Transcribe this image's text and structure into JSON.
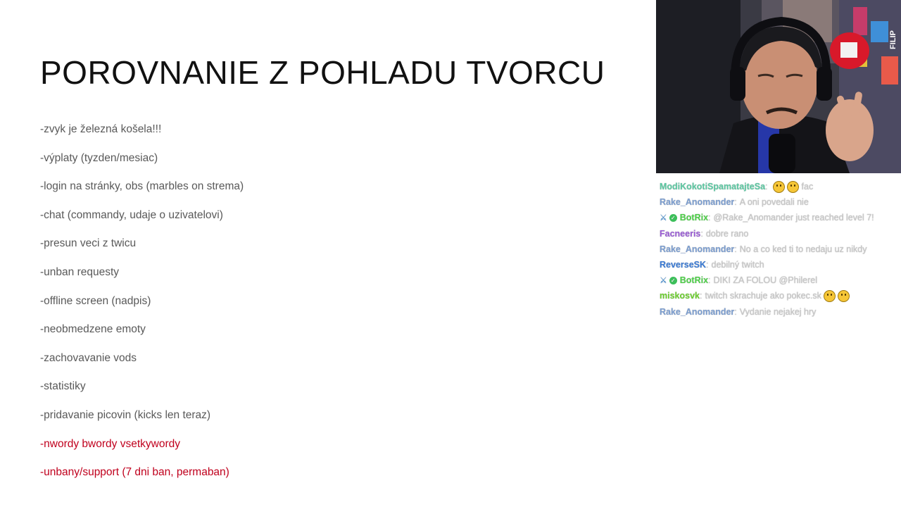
{
  "slide": {
    "title": "POROVNANIE Z POHLADU TVORCU",
    "bullets": [
      {
        "text": "-zvyk je železná košela!!!",
        "color": "#595959"
      },
      {
        "text": "-výplaty (tyzden/mesiac)",
        "color": "#595959"
      },
      {
        "text": "-login na stránky, obs (marbles on strema)",
        "color": "#595959"
      },
      {
        "text": "-chat (commandy, udaje o uzivatelovi)",
        "color": "#595959"
      },
      {
        "text": "-presun veci z twicu",
        "color": "#595959"
      },
      {
        "text": "-unban requesty",
        "color": "#595959"
      },
      {
        "text": "-offline screen (nadpis)",
        "color": "#595959"
      },
      {
        "text": "-neobmedzene emoty",
        "color": "#595959"
      },
      {
        "text": "-zachovavanie vods",
        "color": "#595959"
      },
      {
        "text": "-statistiky",
        "color": "#595959"
      },
      {
        "text": "-pridavanie picovin (kicks len teraz)",
        "color": "#595959"
      },
      {
        "text": "-nwordy bwordy vsetkywordy",
        "color": "#c0001d"
      },
      {
        "text": "-unbany/support (7 dni ban, permaban)",
        "color": "#c0001d"
      }
    ]
  },
  "webcam": {
    "poster_text": "FILIP"
  },
  "chat": {
    "messages": [
      {
        "user": "ModiKokotiSpamatajteSa",
        "user_color": "#5cc9a3",
        "badges": [],
        "text": "fac",
        "emotes_before_text": 2,
        "emotes_after_text": 0
      },
      {
        "user": "Rake_Anomander",
        "user_color": "#7d9fd1",
        "badges": [],
        "text": "A oni povedali nie",
        "emotes_before_text": 0,
        "emotes_after_text": 0
      },
      {
        "user": "BotRix",
        "user_color": "#4fd14a",
        "badges": [
          "sword-icon",
          "verified-icon"
        ],
        "text": "@Rake_Anomander just reached level 7!",
        "emotes_before_text": 0,
        "emotes_after_text": 0
      },
      {
        "user": "Facneeris",
        "user_color": "#9a5cd6",
        "badges": [],
        "text": "dobre rano",
        "emotes_before_text": 0,
        "emotes_after_text": 0
      },
      {
        "user": "Rake_Anomander",
        "user_color": "#7d9fd1",
        "badges": [],
        "text": "No a co ked ti to nedaju uz nikdy",
        "emotes_before_text": 0,
        "emotes_after_text": 0
      },
      {
        "user": "ReverseSK",
        "user_color": "#3a7bd5",
        "badges": [],
        "text": "debilný twitch",
        "emotes_before_text": 0,
        "emotes_after_text": 0
      },
      {
        "user": "BotRix",
        "user_color": "#4fd14a",
        "badges": [
          "sword-icon",
          "verified-icon"
        ],
        "text": "DIKI ZA FOLOU @Philerel",
        "emotes_before_text": 0,
        "emotes_after_text": 0
      },
      {
        "user": "miskosvk",
        "user_color": "#6ccf2e",
        "badges": [],
        "text": "twitch skrachuje ako pokec.sk",
        "emotes_before_text": 0,
        "emotes_after_text": 2
      },
      {
        "user": "Rake_Anomander",
        "user_color": "#7d9fd1",
        "badges": [],
        "text": "Vydanie nejakej hry",
        "emotes_before_text": 0,
        "emotes_after_text": 0
      }
    ]
  }
}
